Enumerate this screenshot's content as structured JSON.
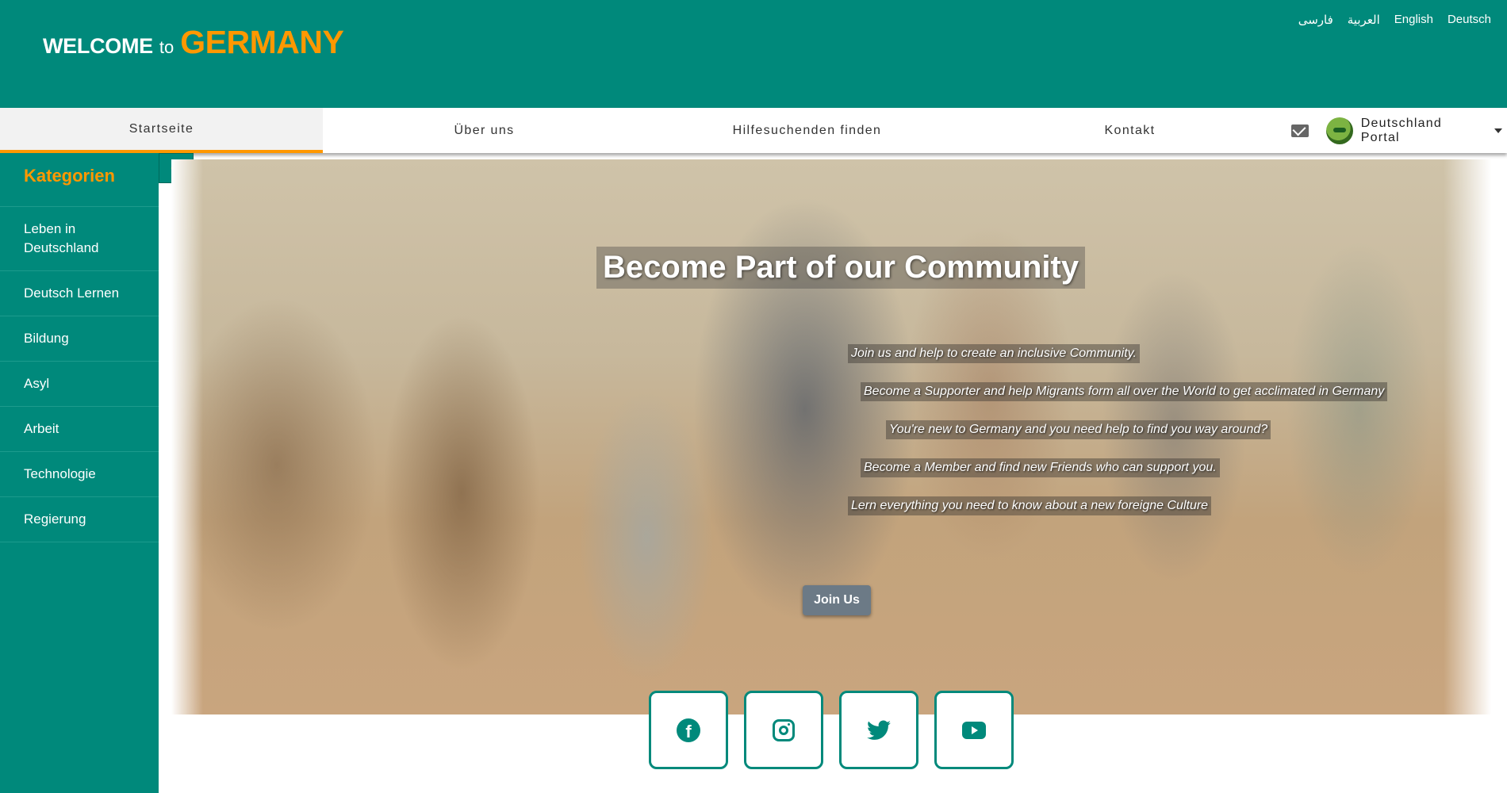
{
  "header": {
    "brand": {
      "welcome": "WELCOME",
      "to": "to",
      "country": "GERMANY"
    },
    "languages": [
      "فارسی",
      "العربية",
      "English",
      "Deutsch"
    ]
  },
  "nav": {
    "items": [
      "Startseite",
      "Über uns",
      "Hilfesuchenden finden",
      "Kontakt"
    ],
    "active_index": 0,
    "mail_icon": "mail-icon",
    "portal_label": "Deutschland Portal"
  },
  "sidebar": {
    "title": "Kategorien",
    "items": [
      "Leben in Deutschland",
      "Deutsch Lernen",
      "Bildung",
      "Asyl",
      "Arbeit",
      "Technologie",
      "Regierung"
    ]
  },
  "hero": {
    "title": "Become Part of our Community",
    "lines": [
      "Join us and help to create an inclusive Community.",
      "Become a Supporter and help Migrants form all over the World to get acclimated in Germany",
      "You're new to Germany and you need help to find you way around?",
      "Become a Member and find new Friends who can support you.",
      "Lern everything you need to know about a new foreigne Culture"
    ],
    "join_label": "Join Us"
  },
  "social": [
    "facebook-icon",
    "instagram-icon",
    "twitter-icon",
    "youtube-icon"
  ],
  "colors": {
    "primary": "#00897b",
    "accent": "#ff9800"
  }
}
